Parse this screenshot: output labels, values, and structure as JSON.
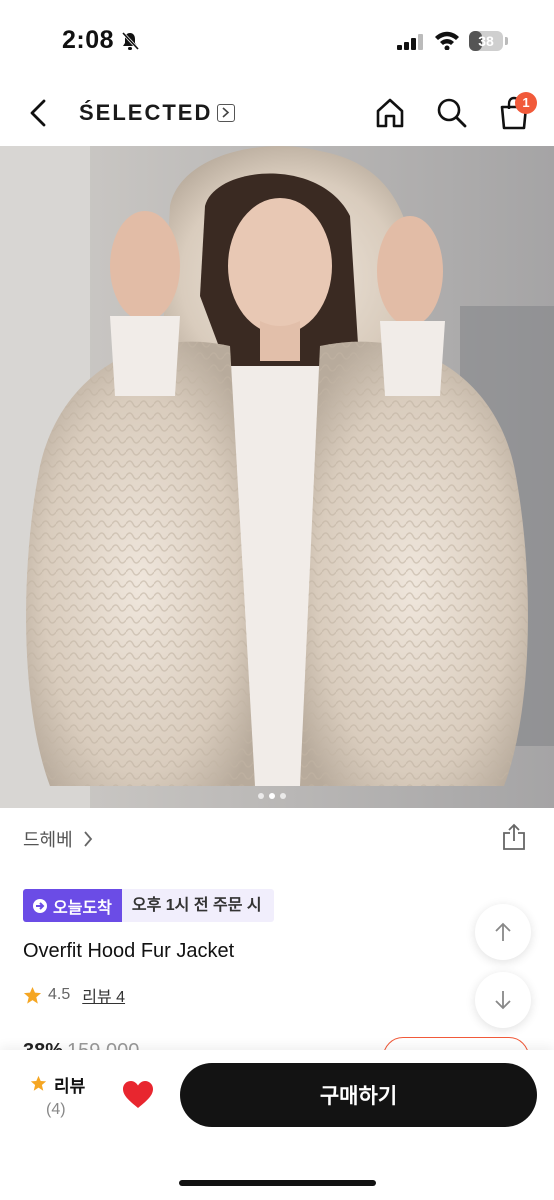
{
  "status_bar": {
    "time": "2:08",
    "battery": "38",
    "battery_level": 0.38
  },
  "header": {
    "brand": "ŚELECTED",
    "cart_count": "1"
  },
  "icons": [
    "bell-slash-icon",
    "signal-icon",
    "wifi-icon",
    "back-arrow-icon",
    "chevron-right-icon",
    "home-icon",
    "search-icon",
    "shopping-bag-icon",
    "share-icon",
    "arrow-up-icon",
    "arrow-down-icon",
    "star-icon",
    "heart-icon"
  ],
  "gallery": {
    "pages": 3,
    "active_page": 2
  },
  "product": {
    "seller": "드헤베",
    "delivery_badge": "오늘도착",
    "delivery_note": "오후 1시 전 주문 시",
    "name": "Overfit Hood Fur Jacket",
    "rating": "4.5",
    "review_link": "리뷰 4",
    "discount": "38%",
    "original_price": "159,000"
  },
  "bottom_bar": {
    "review_label": "리뷰",
    "review_count": "(4)",
    "buy_label": "구매하기"
  },
  "colors": {
    "accent": "#f15a3a",
    "badge_purple": "#6b4ce6",
    "heart": "#e8262f",
    "star": "#f5a623",
    "button": "#131313"
  }
}
